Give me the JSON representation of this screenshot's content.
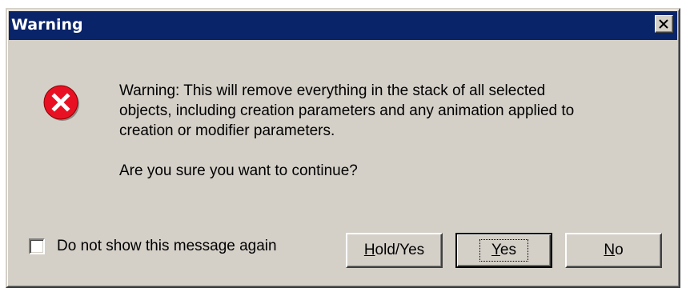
{
  "window": {
    "title": "Warning",
    "close_icon": "close-x-icon"
  },
  "icon": {
    "name": "error-icon",
    "color": "#e81123"
  },
  "message": {
    "line1": "Warning: This will remove everything in the stack of all selected",
    "line2": "objects, including creation parameters and any animation applied to",
    "line3": "creation or modifier parameters.",
    "question": "Are you sure you want to continue?"
  },
  "checkbox": {
    "label": "Do not show this message again",
    "checked": false
  },
  "buttons": {
    "hold_yes": {
      "mnemonic": "H",
      "rest": "old/Yes"
    },
    "yes": {
      "mnemonic": "Y",
      "rest": "es",
      "default": true
    },
    "no": {
      "mnemonic": "N",
      "rest": "o"
    }
  },
  "colors": {
    "titlebar": "#0a246a",
    "face": "#d4d0c8"
  }
}
